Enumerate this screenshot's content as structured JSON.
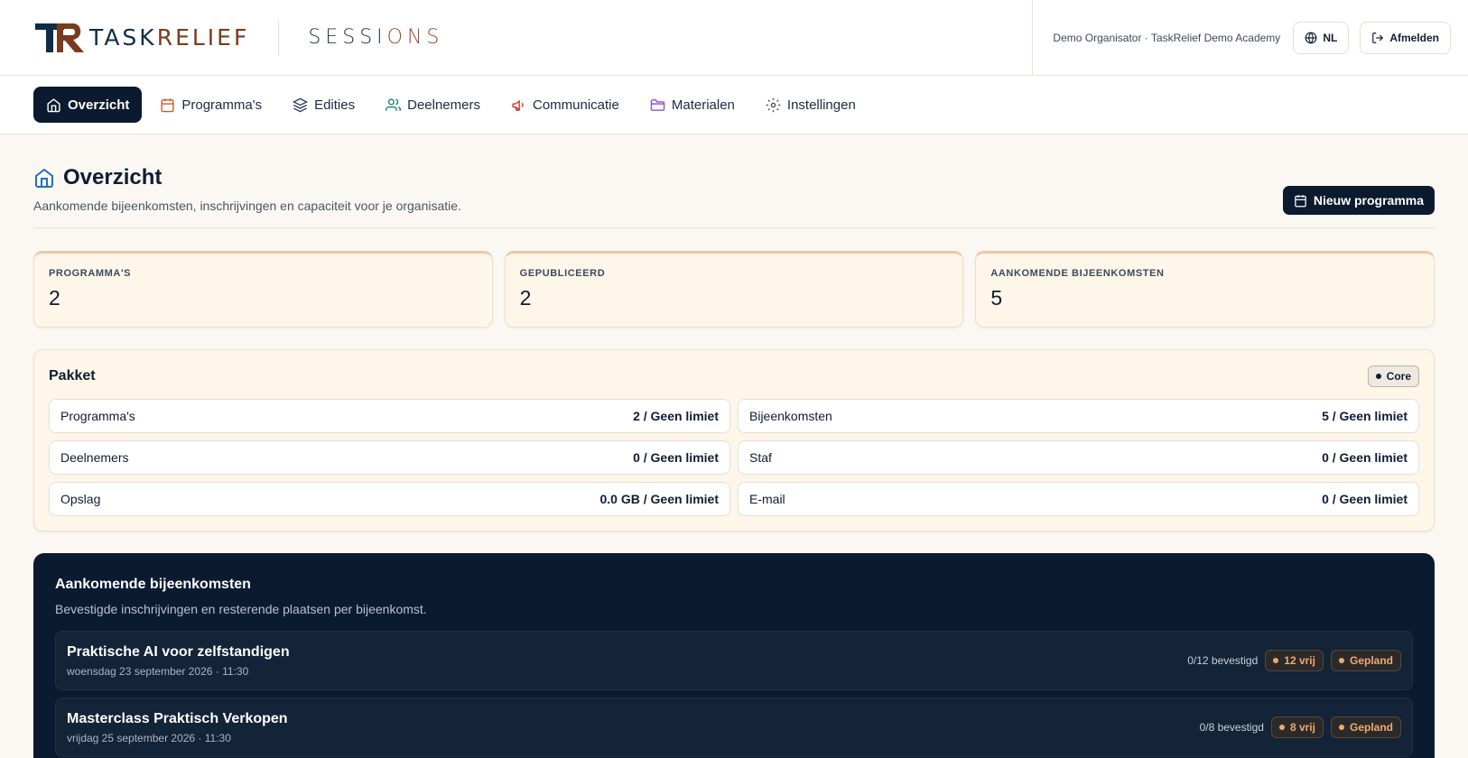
{
  "header": {
    "brand_left": "TASK",
    "brand_right": "RELIEF",
    "product_left": "SESSI",
    "product_right": "ONS",
    "org_label": "Demo Organisator · TaskRelief Demo Academy",
    "language": "NL",
    "logout": "Afmelden"
  },
  "nav": {
    "items": [
      {
        "label": "Overzicht",
        "icon": "home-icon"
      },
      {
        "label": "Programma's",
        "icon": "calendar-icon"
      },
      {
        "label": "Edities",
        "icon": "layers-icon"
      },
      {
        "label": "Deelnemers",
        "icon": "users-icon"
      },
      {
        "label": "Communicatie",
        "icon": "megaphone-icon"
      },
      {
        "label": "Materialen",
        "icon": "folder-icon"
      },
      {
        "label": "Instellingen",
        "icon": "gear-icon"
      }
    ],
    "active_index": 0
  },
  "page": {
    "title": "Overzicht",
    "subtitle": "Aankomende bijeenkomsten, inschrijvingen en capaciteit voor je organisatie.",
    "new_button": "Nieuw programma"
  },
  "stats": [
    {
      "label": "Programma's",
      "value": "2"
    },
    {
      "label": "Gepubliceerd",
      "value": "2"
    },
    {
      "label": "Aankomende bijeenkomsten",
      "value": "5"
    }
  ],
  "package": {
    "title": "Pakket",
    "badge": "Core",
    "limits": [
      {
        "label": "Programma's",
        "value": "2 / Geen limiet"
      },
      {
        "label": "Bijeenkomsten",
        "value": "5 / Geen limiet"
      },
      {
        "label": "Deelnemers",
        "value": "0 / Geen limiet"
      },
      {
        "label": "Staf",
        "value": "0 / Geen limiet"
      },
      {
        "label": "Opslag",
        "value": "0.0 GB / Geen limiet"
      },
      {
        "label": "E-mail",
        "value": "0 / Geen limiet"
      }
    ]
  },
  "upcoming": {
    "title": "Aankomende bijeenkomsten",
    "subtitle": "Bevestigde inschrijvingen en resterende plaatsen per bijeenkomst.",
    "sessions": [
      {
        "name": "Praktische AI voor zelfstandigen",
        "date": "woensdag 23 september 2026 · 11:30",
        "confirmed": "0/12 bevestigd",
        "free": "12 vrij",
        "status": "Gepland"
      },
      {
        "name": "Masterclass Praktisch Verkopen",
        "date": "vrijdag 25 september 2026 · 11:30",
        "confirmed": "0/8 bevestigd",
        "free": "8 vrij",
        "status": "Gepland"
      }
    ]
  },
  "colors": {
    "navy": "#0c1a30",
    "accent": "#f0a870",
    "card_bg": "#fdf6e9",
    "page_bg": "#fbf8f3"
  }
}
